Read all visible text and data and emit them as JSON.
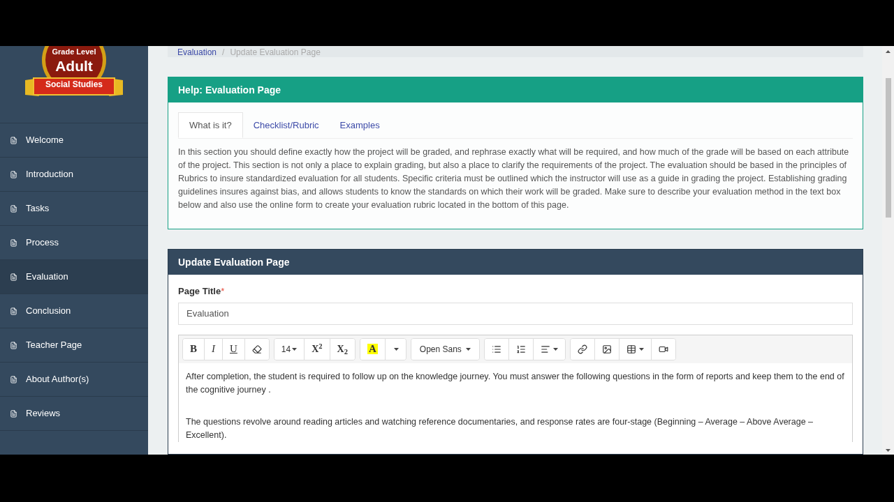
{
  "logo": {
    "top": "Grade Level",
    "main": "Adult",
    "ribbon": "Social Studies"
  },
  "sidebar": {
    "items": [
      {
        "label": "Welcome",
        "selected": false
      },
      {
        "label": "Introduction",
        "selected": false
      },
      {
        "label": "Tasks",
        "selected": false
      },
      {
        "label": "Process",
        "selected": false
      },
      {
        "label": "Evaluation",
        "selected": true
      },
      {
        "label": "Conclusion",
        "selected": false
      },
      {
        "label": "Teacher Page",
        "selected": false
      },
      {
        "label": "About Author(s)",
        "selected": false
      },
      {
        "label": "Reviews",
        "selected": false
      }
    ]
  },
  "breadcrumb": [
    "Evaluation",
    "/",
    "Update Evaluation Page"
  ],
  "help": {
    "title": "Help: Evaluation Page",
    "tabs": [
      {
        "label": "What is it?",
        "selected": true
      },
      {
        "label": "Checklist/Rubric",
        "selected": false
      },
      {
        "label": "Examples",
        "selected": false
      }
    ],
    "text": "In this section you should define exactly how the project will be graded, and rephrase exactly what will be required, and how much of the grade will be based on each attribute of the project. This section is not only a place to explain grading, but also a place to clarify the requirements of the project. The evaluation should be based in the principles of Rubrics to insure standardized evaluation for all students. Specific criteria must be outlined which the instructor will use as a guide in grading the project. Establishing grading guidelines insures against bias, and allows students to know the standards on which their work will be graded. Make sure to describe your evaluation method in the text box below and also use the online form to create your evaluation rubric located in the bottom of this page."
  },
  "form": {
    "title": "Update Evaluation Page",
    "field_label": "Page Title",
    "required_mark": "*",
    "page_title": "Evaluation",
    "toolbar": [
      [
        {
          "kind": "bold",
          "label": "B"
        },
        {
          "kind": "italic",
          "label": "I"
        },
        {
          "kind": "underline",
          "label": "U"
        },
        {
          "kind": "eraser"
        }
      ],
      [
        {
          "kind": "size",
          "label": "14"
        },
        {
          "kind": "superscript",
          "label": "X$^{2}$"
        },
        {
          "kind": "subscript",
          "label": "X$_{2}$"
        }
      ],
      [
        {
          "kind": "highlight",
          "label": "A"
        },
        {
          "kind": "dropdown"
        }
      ],
      [
        {
          "kind": "font",
          "label": "Open Sans"
        }
      ],
      [
        {
          "kind": "bullets"
        },
        {
          "kind": "numbers"
        },
        {
          "kind": "align"
        }
      ],
      [
        {
          "kind": "link"
        },
        {
          "kind": "image"
        },
        {
          "kind": "table"
        },
        {
          "kind": "video"
        }
      ]
    ],
    "paragraphs": [
      "After completion, the student is required to follow up on the knowledge journey. You must answer the following questions in the form of reports and keep them to the end of the cognitive journey .",
      "The questions revolve around reading articles and watching reference documentaries, and response rates are four-stage (Beginning – Average – Above Average – Excellent)."
    ]
  }
}
